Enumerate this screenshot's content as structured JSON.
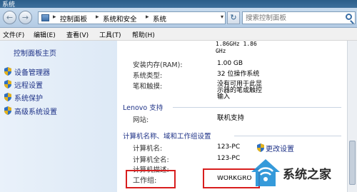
{
  "window": {
    "title": "系统"
  },
  "address": {
    "crumbs": [
      "控制面板",
      "系统和安全",
      "系统"
    ]
  },
  "search": {
    "placeholder": "搜索控制面板"
  },
  "menu": [
    "文件(F)",
    "编辑(E)",
    "查看(V)",
    "工具(T)",
    "帮助(H)"
  ],
  "sidebar": {
    "home": "控制面板主页",
    "items": [
      {
        "label": "设备管理器",
        "icon": "shield-icon"
      },
      {
        "label": "远程设置",
        "icon": "shield-icon"
      },
      {
        "label": "系统保护",
        "icon": "shield-icon"
      },
      {
        "label": "高级系统设置",
        "icon": "shield-icon"
      }
    ]
  },
  "system": {
    "cpu": "1.86GHz  1.86 GHz",
    "rows": [
      {
        "label": "安装内存(RAM):",
        "value": "1.00 GB"
      },
      {
        "label": "系统类型:",
        "value": "32 位操作系统"
      },
      {
        "label": "笔和触摸:",
        "value": "没有可用于此显示器的笔或触控输入"
      }
    ]
  },
  "support": {
    "title": "Lenovo 支持",
    "rows": [
      {
        "label": "网站:",
        "value": "联机支持"
      }
    ]
  },
  "computer": {
    "title": "计算机名称、域和工作组设置",
    "change_label": "更改设置",
    "rows": [
      {
        "label": "计算机名:",
        "value": "123-PC"
      },
      {
        "label": "计算机全名:",
        "value": "123-PC"
      },
      {
        "label": "计算机描述:",
        "value": ""
      },
      {
        "label": "工作组:",
        "value": "WORKGROUP"
      }
    ]
  },
  "watermark": {
    "text": "系统之家"
  },
  "colors": {
    "link": "#1e3287",
    "highlight": "#d81e1e",
    "titlebar": "#2b5d8a"
  }
}
